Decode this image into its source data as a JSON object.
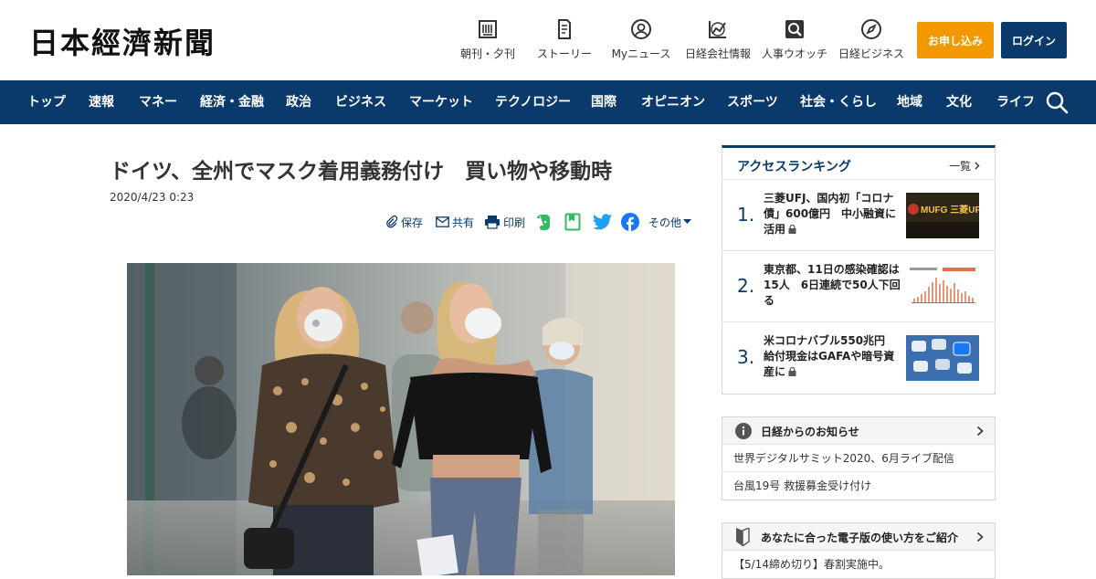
{
  "site": {
    "logo": "日本經濟新聞"
  },
  "header_nav": [
    {
      "label": "朝刊・夕刊",
      "icon": "newspaper-icon"
    },
    {
      "label": "ストーリー",
      "icon": "story-icon"
    },
    {
      "label": "Myニュース",
      "icon": "person-icon"
    },
    {
      "label": "日経会社情報",
      "icon": "chart-icon"
    },
    {
      "label": "人事ウオッチ",
      "icon": "search-person-icon"
    },
    {
      "label": "日経ビジネス",
      "icon": "compass-icon"
    }
  ],
  "auth": {
    "subscribe": "お申し込み",
    "login": "ログイン"
  },
  "main_nav": [
    "トップ",
    "速報",
    "マネー",
    "経済・金融",
    "政治",
    "ビジネス",
    "マーケット",
    "テクノロジー",
    "国際",
    "オピニオン",
    "スポーツ",
    "社会・くらし",
    "地域",
    "文化",
    "ライフ"
  ],
  "article": {
    "title": "ドイツ、全州でマスク着用義務付け　買い物や移動時",
    "date": "2020/4/23 0:23"
  },
  "share": {
    "save": "保存",
    "share": "共有",
    "print": "印刷",
    "more": "その他"
  },
  "ranking": {
    "title": "アクセスランキング",
    "more": "一覧",
    "items": [
      {
        "rank": "1.",
        "text": "三菱UFJ、国内初「コロナ債」600億円　中小融資に活用",
        "locked": true,
        "thumb_text": "MUFG 三菱UFJ"
      },
      {
        "rank": "2.",
        "text": "東京都、11日の感染確認は15人　6日連続で50人下回る",
        "locked": false
      },
      {
        "rank": "3.",
        "text": "米コロナバブル550兆円　給付現金はGAFAや暗号資産に",
        "locked": true
      }
    ]
  },
  "notices": {
    "title": "日経からのお知らせ",
    "items": [
      "世界デジタルサミット2020、6月ライブ配信",
      "台風19号 救援募金受け付け"
    ]
  },
  "guide": {
    "title": "あなたに合った電子版の使い方をご紹介",
    "items": [
      "【5/14締め切り】春割実施中。"
    ]
  },
  "colors": {
    "navy": "#0a3a6b",
    "orange": "#f39800",
    "evernote": "#2dbe60",
    "twitter": "#1da1f2",
    "facebook": "#1877f2"
  }
}
